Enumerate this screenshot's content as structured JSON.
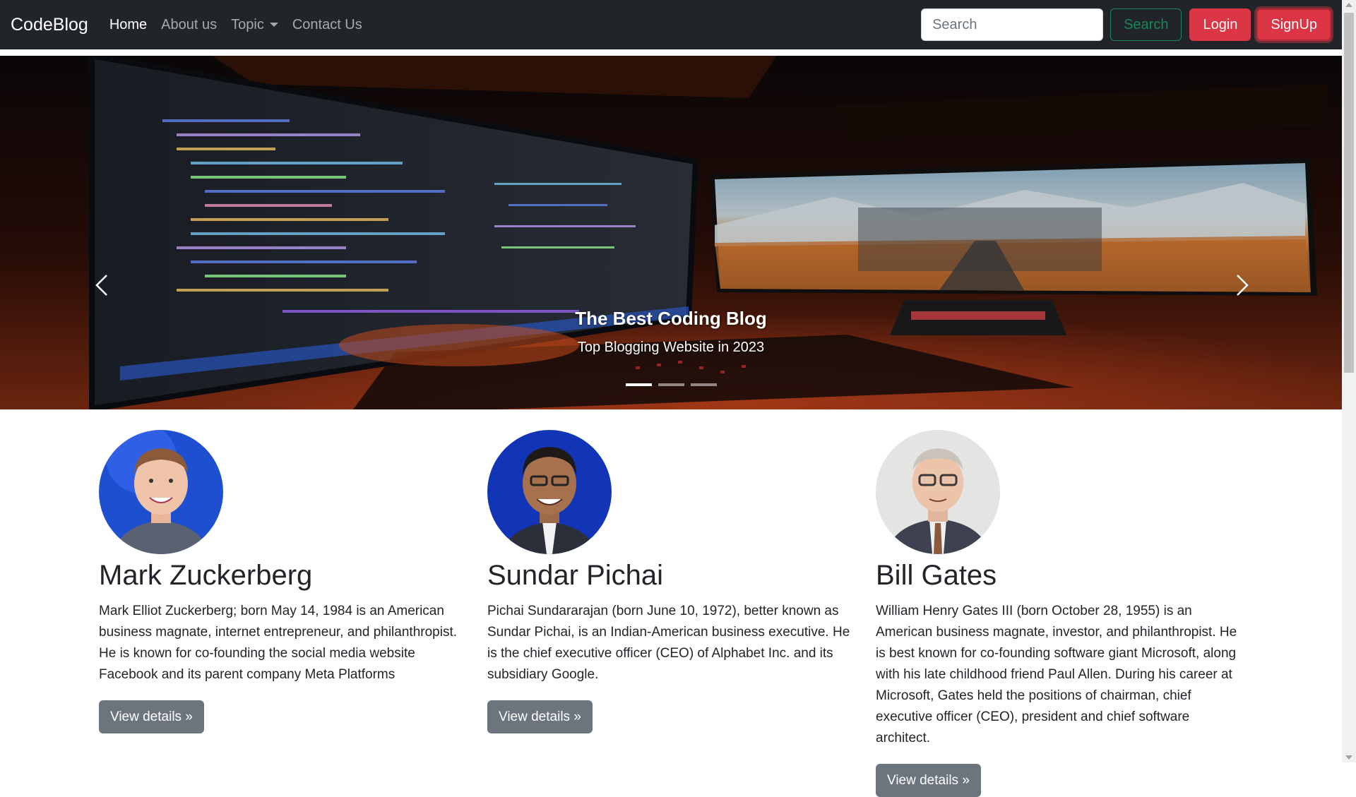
{
  "navbar": {
    "brand": "CodeBlog",
    "links": [
      {
        "label": "Home"
      },
      {
        "label": "About us"
      },
      {
        "label": "Topic"
      },
      {
        "label": "Contact Us"
      }
    ],
    "search_placeholder": "Search",
    "search_button": "Search",
    "login_button": "Login",
    "signup_button": "SignUp"
  },
  "carousel": {
    "caption_title": "The Best Coding Blog",
    "caption_subtitle": "Top Blogging Website in 2023",
    "slide_count": 3,
    "active_slide": 1
  },
  "people": [
    {
      "name": "Mark Zuckerberg",
      "bio": "Mark Elliot Zuckerberg; born May 14, 1984 is an American business magnate, internet entrepreneur, and philanthropist. He is known for co-founding the social media website Facebook and its parent company Meta Platforms",
      "button": "View details »"
    },
    {
      "name": "Sundar Pichai",
      "bio": "Pichai Sundararajan (born June 10, 1972), better known as Sundar Pichai, is an Indian-American business executive. He is the chief executive officer (CEO) of Alphabet Inc. and its subsidiary Google.",
      "button": "View details »"
    },
    {
      "name": "Bill Gates",
      "bio": "William Henry Gates III (born October 28, 1955) is an American business magnate, investor, and philanthropist. He is best known for co-founding software giant Microsoft, along with his late childhood friend Paul Allen. During his career at Microsoft, Gates held the positions of chairman, chief executive officer (CEO), president and chief software architect.",
      "button": "View details »"
    }
  ],
  "colors": {
    "navbar_bg": "#212529",
    "danger": "#dc3545",
    "success": "#198754",
    "secondary": "#6c757d"
  }
}
